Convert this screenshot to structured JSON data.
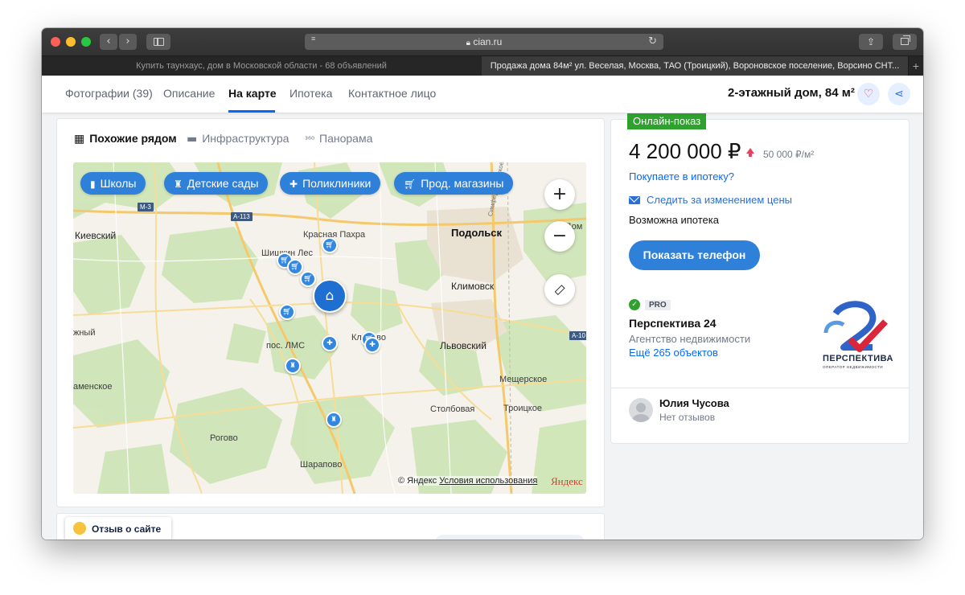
{
  "browser": {
    "url": "cian.ru",
    "tabs": [
      {
        "title": "Купить таунхаус, дом в Московской области - 68 объявлений"
      },
      {
        "title": "Продажа дома 84м² ул. Веселая, Москва, ТАО (Троицкий), Вороновское поселение, Ворсино СНТ..."
      }
    ],
    "lock_icon": "lock-icon",
    "new_tab_label": "+"
  },
  "topnav": {
    "items": [
      {
        "label": "Фотографии (39)"
      },
      {
        "label": "Описание"
      },
      {
        "label": "На карте"
      },
      {
        "label": "Ипотека"
      },
      {
        "label": "Контактное лицо"
      }
    ],
    "active_index": 2,
    "title": "2-этажный дом, 84 м²"
  },
  "map_section": {
    "tabs": [
      {
        "label": "Похожие рядом",
        "icon": "grid-icon"
      },
      {
        "label": "Инфраструктура",
        "icon": "shop-icon"
      },
      {
        "label": "Панорама",
        "icon": "360-icon"
      }
    ],
    "chips": [
      {
        "label": "Школы",
        "icon": "book-icon"
      },
      {
        "label": "Детские сады",
        "icon": "kindergarten-icon"
      },
      {
        "label": "Поликлиники",
        "icon": "cross-icon"
      },
      {
        "label": "Прод. магазины",
        "icon": "cart-icon"
      }
    ],
    "zoom_in": "+",
    "zoom_out": "−",
    "labels": {
      "kievsky": "Киевский",
      "krasnaya_pakhra": "Красная Пахра",
      "shishkin_les": "Шишкин Лес",
      "podolsk": "Подольск",
      "klimovsk": "Климовск",
      "pos_lms": "пос. ЛМС",
      "klenovo": "Клёново",
      "lvovsky": "Львовский",
      "meshcherskoe": "Мещерское",
      "stolbovaya": "Столбовая",
      "troitskoe": "Троицкое",
      "rogovo": "Рогово",
      "sharapovo": "Шарапово",
      "kamenskoe": "аменское",
      "zhny": "жный",
      "dom": "Дом",
      "simferopol_sh": "Симферопольское ш."
    },
    "road_badges": [
      "М-3",
      "А-113",
      "А-10"
    ],
    "copyright": "© Яндекс",
    "terms": "Условия использования",
    "yandex": "Яндекс"
  },
  "review": {
    "label": "Отзыв о сайте"
  },
  "offer": {
    "online_badge": "Онлайн-показ",
    "price": "4 200 000 ₽",
    "price_per_m2": "50 000 ₽/м²",
    "mortgage_question": "Покупаете в ипотеку?",
    "follow_price": "Следить за изменением цены",
    "mortgage_possible": "Возможна ипотека",
    "show_phone": "Показать телефон"
  },
  "agency": {
    "pro_badge": "PRO",
    "name": "Перспектива 24",
    "type": "Агентство недвижимости",
    "more": "Ещё 265 объектов",
    "logo_text": "ПЕРСПЕКТИВА",
    "logo_sub": "ОПЕРАТОР НЕДВИЖИМОСТИ"
  },
  "contact": {
    "name": "Юлия Чусова",
    "reviews": "Нет отзывов"
  },
  "colors": {
    "accent": "#0468ff",
    "button_blue": "#2f80d8",
    "online_green": "#2ea12e",
    "price_up_red": "#e84260"
  }
}
